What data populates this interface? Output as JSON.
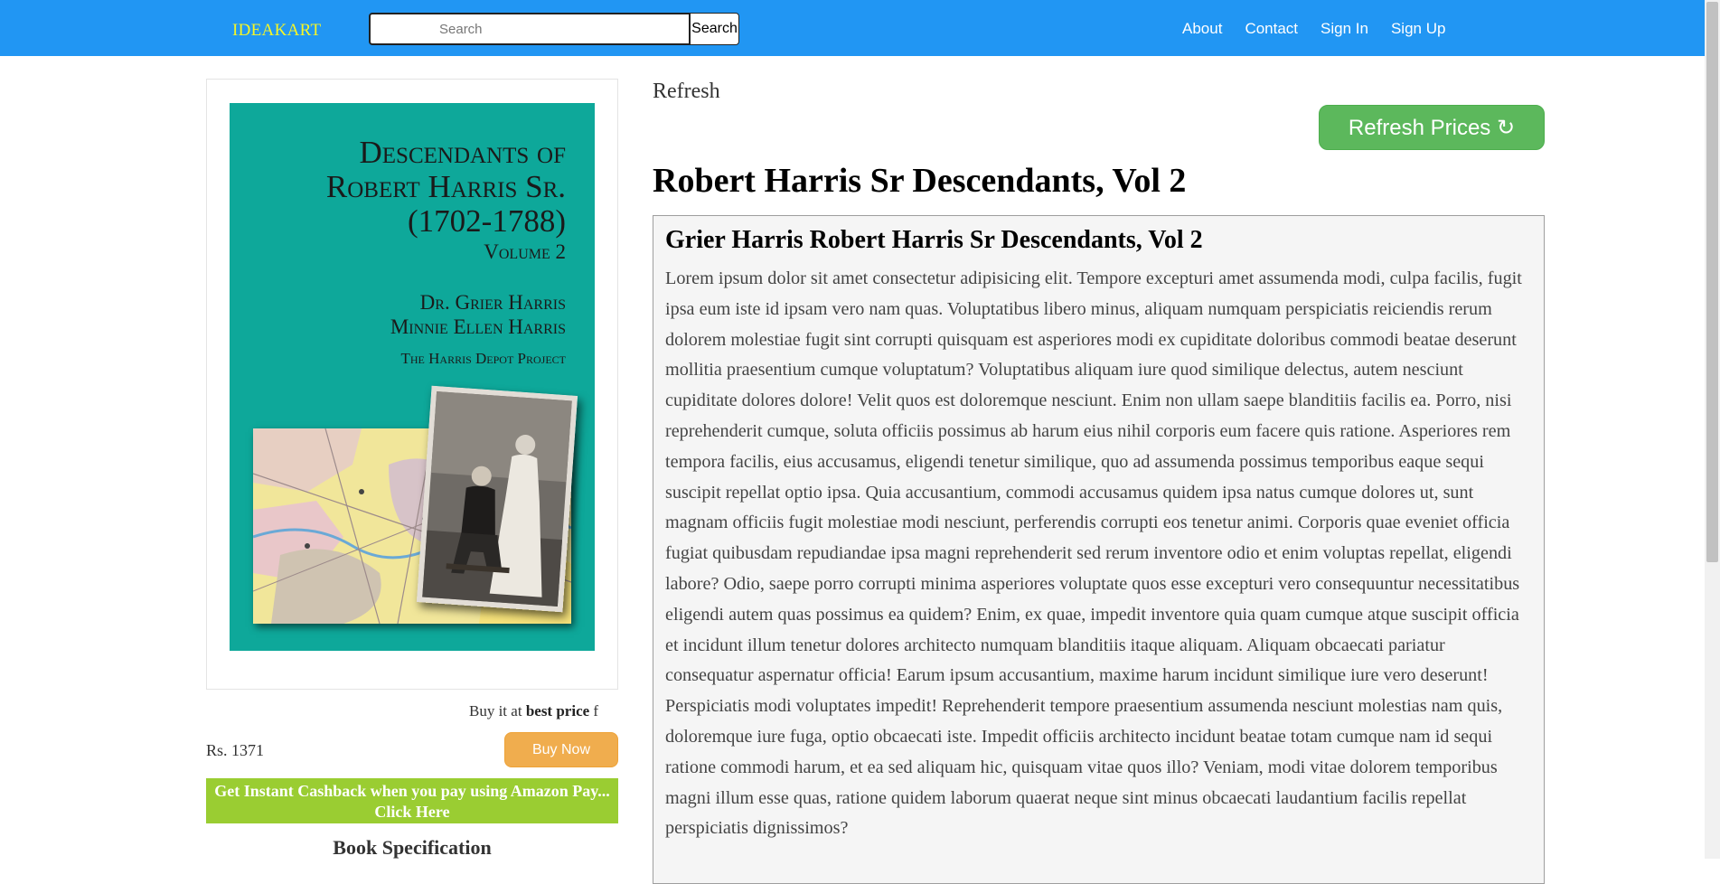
{
  "navbar": {
    "brand": "IDEAKART",
    "search_placeholder": "Search",
    "search_button": "Search",
    "links": [
      "About",
      "Contact",
      "Sign In",
      "Sign Up"
    ]
  },
  "book": {
    "cover": {
      "title_lines": [
        "Descendants of",
        "Robert Harris Sr.",
        "(1702-1788)"
      ],
      "volume": "Volume 2",
      "authors": [
        "Dr. Grier Harris",
        "Minnie Ellen Harris"
      ],
      "project": "The Harris Depot Project",
      "background_color": "#0ea89a"
    },
    "buy_text_prefix": "Buy it at ",
    "buy_text_bold": "best price",
    "buy_text_suffix": " f",
    "price": "Rs. 1371",
    "buy_button": "Buy Now",
    "cashback": "Get Instant Cashback when you pay using Amazon Pay... Click Here",
    "spec_heading": "Book Specification"
  },
  "refresh": {
    "label": "Refresh",
    "button": "Refresh Prices ↻"
  },
  "page_title": "Robert Harris Sr Descendants, Vol 2",
  "description": {
    "title": "Grier Harris Robert Harris Sr Descendants, Vol 2",
    "body": "Lorem ipsum dolor sit amet consectetur adipisicing elit. Tempore excepturi amet assumenda modi, culpa facilis, fugit ipsa eum iste id ipsam vero nam quas. Voluptatibus libero minus, aliquam numquam perspiciatis reiciendis rerum dolorem molestiae fugit sint corrupti quisquam est asperiores modi ex cupiditate doloribus commodi beatae deserunt mollitia praesentium cumque voluptatum? Voluptatibus aliquam iure quod similique delectus, autem nesciunt cupiditate dolores dolore! Velit quos est doloremque nesciunt. Enim non ullam saepe blanditiis facilis ea. Porro, nisi reprehenderit cumque, soluta officiis possimus ab harum eius nihil corporis eum facere quis ratione. Asperiores rem tempora facilis, eius accusamus, eligendi tenetur similique, quo ad assumenda possimus temporibus eaque sequi suscipit repellat optio ipsa. Quia accusantium, commodi accusamus quidem ipsa natus cumque dolores ut, sunt magnam officiis fugit molestiae modi nesciunt, perferendis corrupti eos tenetur animi. Corporis quae eveniet officia fugiat quibusdam repudiandae ipsa magni reprehenderit sed rerum inventore odio et enim voluptas repellat, eligendi labore? Odio, saepe porro corrupti minima asperiores voluptate quos esse excepturi vero consequuntur necessitatibus eligendi autem quas possimus ea quidem? Enim, ex quae, impedit inventore quia quam cumque atque suscipit officia et incidunt illum tenetur dolores architecto numquam blanditiis itaque aliquam. Aliquam obcaecati pariatur consequatur aspernatur officia! Earum ipsum accusantium, maxime harum incidunt similique iure vero deserunt! Perspiciatis modi voluptates impedit! Reprehenderit tempore praesentium assumenda nesciunt molestias nam quis, doloremque iure fuga, optio obcaecati iste. Impedit officiis architecto incidunt beatae totam cumque nam id sequi ratione commodi harum, et ea sed aliquam hic, quisquam vitae quos illo? Veniam, modi vitae dolorem temporibus magni illum esse quas, ratione quidem laborum quaerat neque sint minus obcaecati laudantium facilis repellat perspiciatis dignissimos?"
  }
}
